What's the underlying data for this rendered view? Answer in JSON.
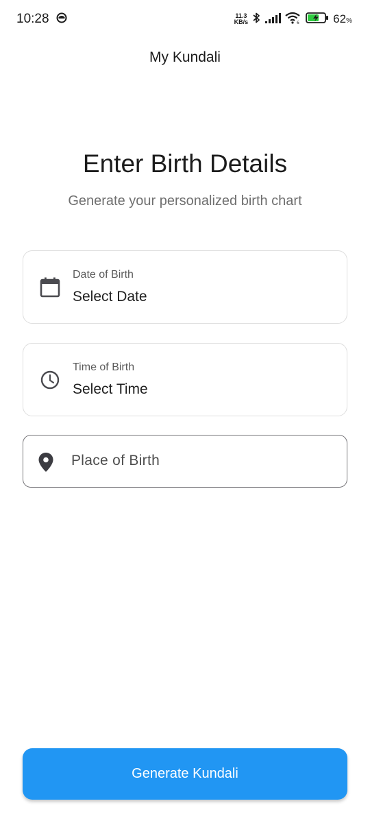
{
  "status_bar": {
    "time": "10:28",
    "net_speed_value": "11.3",
    "net_speed_unit": "KB/s",
    "battery_percent": "62",
    "battery_unit": "%"
  },
  "app_bar": {
    "title": "My Kundali"
  },
  "header": {
    "title": "Enter Birth Details",
    "subtitle": "Generate your personalized birth chart"
  },
  "form": {
    "date": {
      "label": "Date of Birth",
      "value": "Select Date",
      "icon": "calendar-icon"
    },
    "time": {
      "label": "Time of Birth",
      "value": "Select Time",
      "icon": "clock-icon"
    },
    "place": {
      "placeholder": "Place of Birth",
      "value": "",
      "icon": "location-pin-icon"
    }
  },
  "actions": {
    "generate_label": "Generate Kundali"
  },
  "colors": {
    "primary": "#2196f3",
    "icon": "#4a4a4f",
    "card_border": "#dedede",
    "subtitle": "#6f6f6f"
  }
}
